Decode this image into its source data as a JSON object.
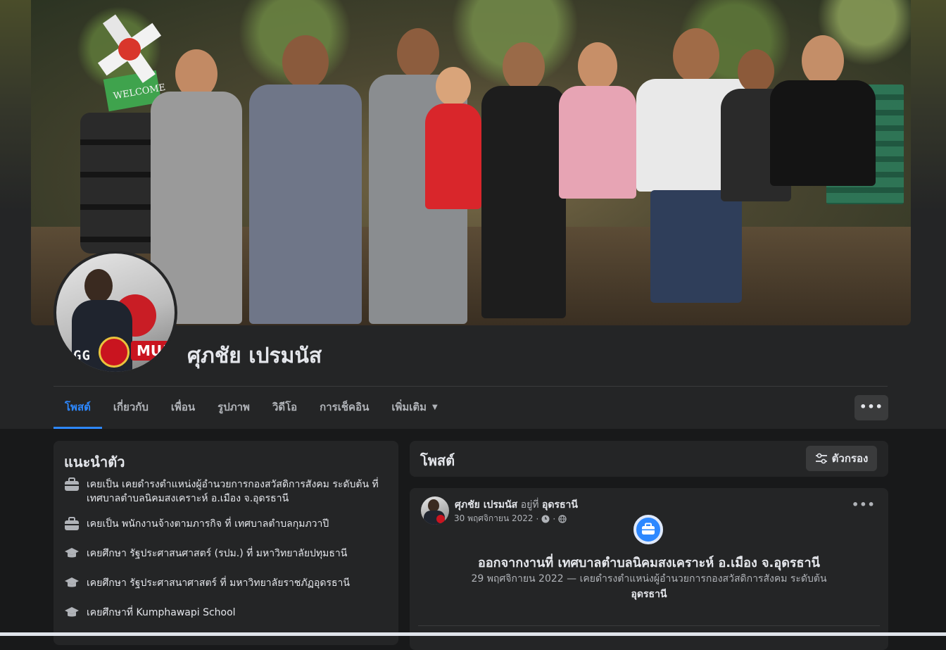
{
  "profile": {
    "name": "ศุภชัย เปรมนัส",
    "avatar_text": "GG",
    "avatar_badge": "MU!"
  },
  "cover": {
    "sign_text": "WELCOME"
  },
  "tabs": [
    {
      "label": "โพสต์",
      "active": true
    },
    {
      "label": "เกี่ยวกับ",
      "active": false
    },
    {
      "label": "เพื่อน",
      "active": false
    },
    {
      "label": "รูปภาพ",
      "active": false
    },
    {
      "label": "วิดีโอ",
      "active": false
    },
    {
      "label": "การเช็คอิน",
      "active": false
    },
    {
      "label": "เพิ่มเติม",
      "active": false
    }
  ],
  "more_button": "•••",
  "intro": {
    "title": "แนะนำตัว",
    "items": [
      {
        "icon": "briefcase-icon",
        "text": "เคยเป็น เคยดำรงตำแหน่งผู้อำนวยการกองสวัสดิการสังคม ระดับต้น ที่ เทศบาลตำบลนิคมสงเคราะห์ อ.เมือง จ.อุดรธานี"
      },
      {
        "icon": "briefcase-icon",
        "text": "เคยเป็น พนักงานจ้างตามภารกิจ ที่ เทศบาลตำบลกุมภวาปี"
      },
      {
        "icon": "graduation-cap-icon",
        "text": "เคยศึกษา รัฐประศาสนศาสตร์ (รปม.) ที่ มหาวิทยาลัยปทุมธานี"
      },
      {
        "icon": "graduation-cap-icon",
        "text": "เคยศึกษา รัฐประศาสนาศาสตร์ ที่ มหาวิทยาลัยราชภัฏอุดรธานี"
      },
      {
        "icon": "graduation-cap-icon",
        "text": "เคยศึกษาที่ Kumphawapi School"
      }
    ]
  },
  "posts": {
    "title": "โพสต์",
    "filter_label": "ตัวกรอง"
  },
  "post": {
    "author": "ศุภชัย เปรมนัส",
    "at_label": "อยู่ที่",
    "location": "อุดรธานี",
    "date": "30 พฤศจิกายน 2022",
    "meta_sep": "·",
    "dots": "•••",
    "headline": "ออกจากงานที่ เทศบาลตำบลนิคมสงเคราะห์ อ.เมือง จ.อุดรธานี",
    "sub_date": "29 พฤศจิกายน 2022 —",
    "sub_text": "เคยดำรงตำแหน่งผู้อำนวยการกองสวัสดิการสังคม ระดับต้น",
    "sub_place": "อุดรธานี"
  }
}
